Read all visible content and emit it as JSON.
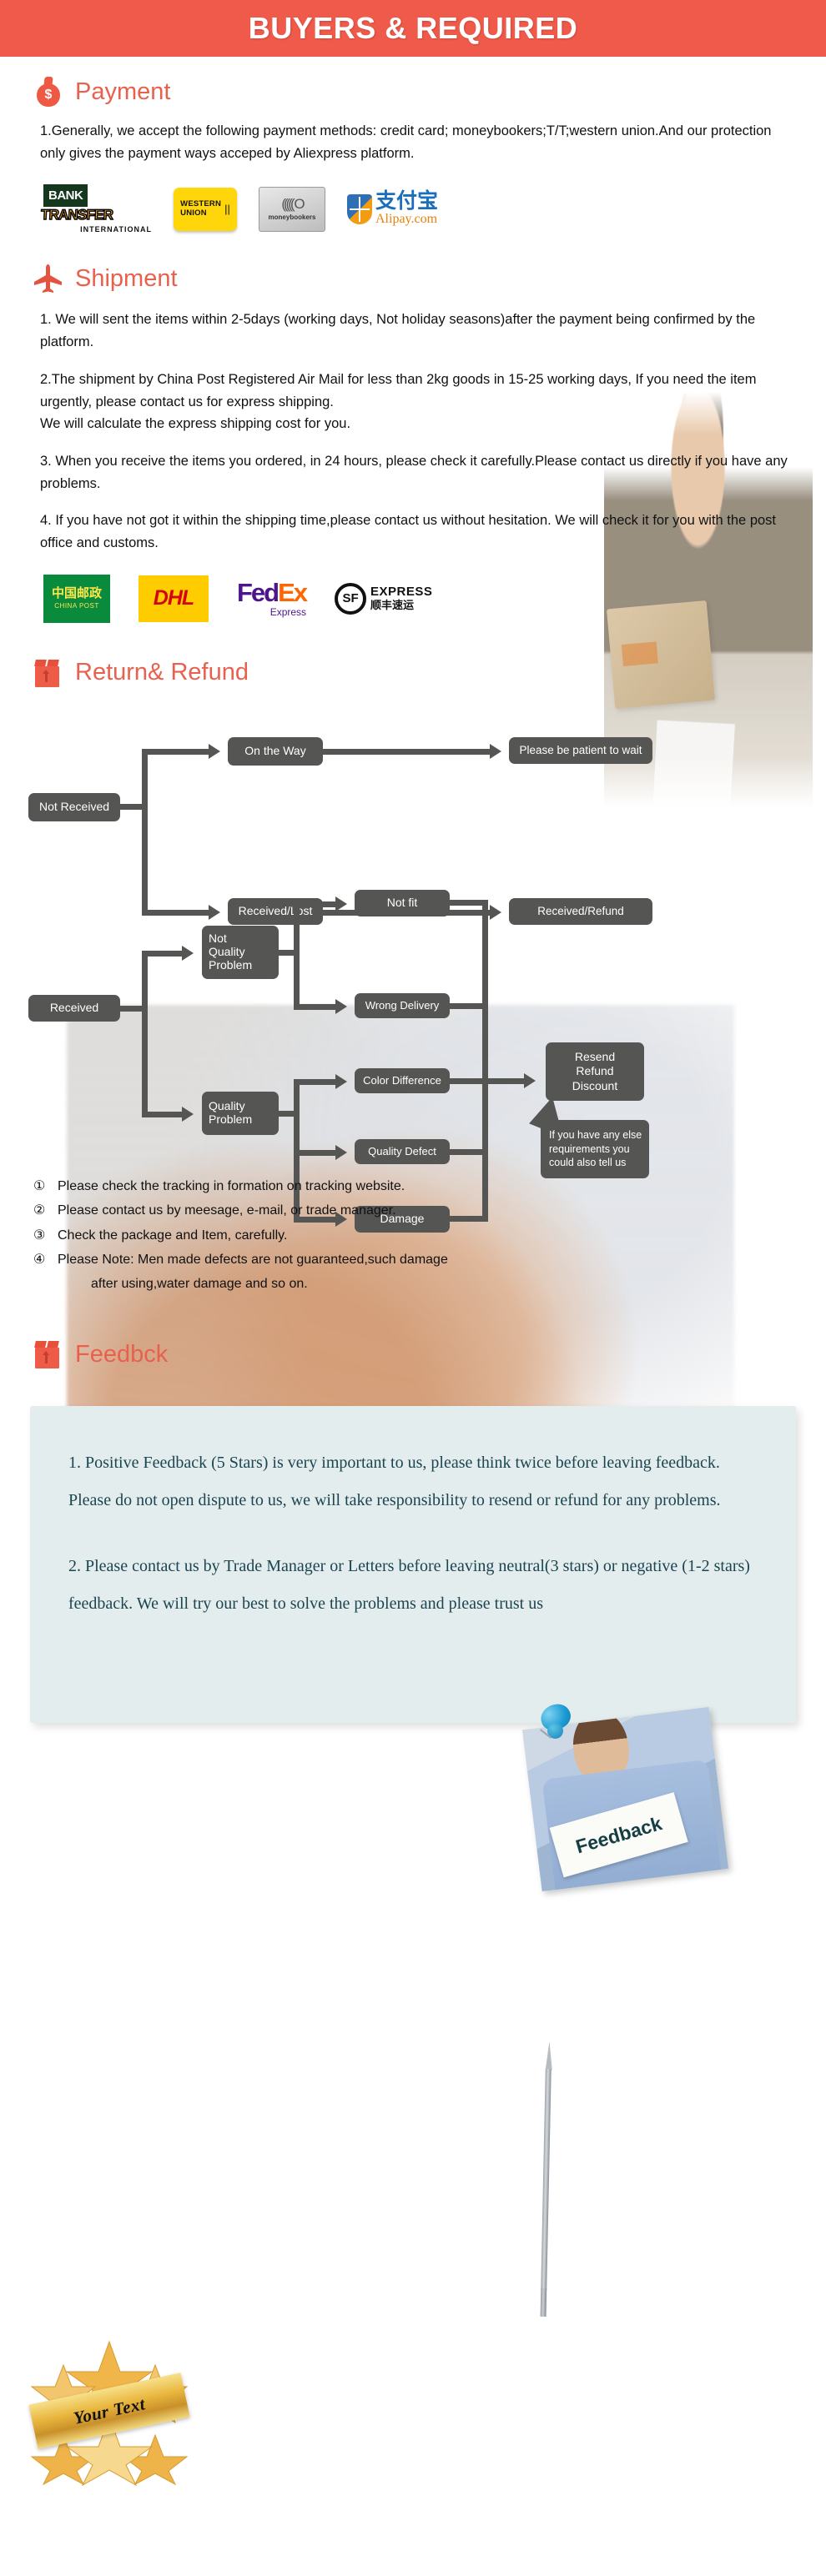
{
  "header": {
    "title": "BUYERS & REQUIRED"
  },
  "payment": {
    "icon": "money-bag-icon",
    "title": "Payment",
    "paragraphs": [
      "1.Generally, we accept the following payment methods: credit card; moneybookers;T/T;western union.And our protection only gives the payment ways acceped by Aliexpress platform."
    ],
    "logos": [
      {
        "name": "bank-transfer-logo",
        "main": "BANK",
        "accent": "TRANSFER",
        "sub": "INTERNATIONAL"
      },
      {
        "name": "western-union-logo",
        "line1": "WESTERN",
        "line2": "UNION"
      },
      {
        "name": "moneybookers-logo",
        "label": "moneybookers"
      },
      {
        "name": "alipay-logo",
        "zh": "支付宝",
        "domain": "Alipay.com"
      }
    ]
  },
  "shipment": {
    "icon": "airplane-icon",
    "title": "Shipment",
    "paragraphs": [
      "1. We will sent the items within 2-5days (working days, Not holiday seasons)after the payment being confirmed by the platform.",
      "2.The shipment by China Post Registered Air Mail for less than  2kg goods in 15-25 working days, If  you need the item urgently, please contact us for express shipping.",
      "We will calculate the express shipping cost for you.",
      "3. When you receive the items you ordered, in 24 hours, please check it carefully.Please contact us directly if you have any problems.",
      "4. If you have not got it within the shipping time,please contact us without hesitation. We will check it for you with the post office and customs."
    ],
    "logos": [
      {
        "name": "china-post-logo",
        "cn": "中国邮政",
        "en": "CHINA POST"
      },
      {
        "name": "dhl-logo",
        "label": "DHL"
      },
      {
        "name": "fedex-logo",
        "fed": "Fed",
        "ex": "Ex",
        "sub": "Express"
      },
      {
        "name": "sf-express-logo",
        "mark": "SF",
        "en": "EXPRESS",
        "cn": "顺丰速运"
      }
    ]
  },
  "return_refund": {
    "icon": "return-box-icon",
    "title": "Return& Refund",
    "flowchart": {
      "nodes": [
        {
          "id": "not-received",
          "label": "Not Received"
        },
        {
          "id": "on-the-way",
          "label": "On the Way"
        },
        {
          "id": "please-wait",
          "label": "Please be patient to wait"
        },
        {
          "id": "received-lost",
          "label": "Received/Lost"
        },
        {
          "id": "received-refund",
          "label": "Received/Refund"
        },
        {
          "id": "received",
          "label": "Received"
        },
        {
          "id": "not-quality-problem",
          "label": "Not\nQuality\nProblem"
        },
        {
          "id": "quality-problem",
          "label": "Quality\nProblem"
        },
        {
          "id": "not-fit",
          "label": "Not fit"
        },
        {
          "id": "wrong-delivery",
          "label": "Wrong Delivery"
        },
        {
          "id": "color-difference",
          "label": "Color Difference"
        },
        {
          "id": "quality-defect",
          "label": "Quality Defect"
        },
        {
          "id": "damage",
          "label": "Damage"
        },
        {
          "id": "resend-refund-discount",
          "label": "Resend\nRefund\nDiscount"
        },
        {
          "id": "callout",
          "label": "If you have any else\nrequirements you\ncould also tell us"
        }
      ]
    },
    "notes": [
      {
        "num": "①",
        "text": "Please check the tracking in formation on tracking website."
      },
      {
        "num": "②",
        "text": "Please contact us by meesage, e-mail, or trade manager."
      },
      {
        "num": "③",
        "text": "Check the package and Item, carefully."
      },
      {
        "num": "④",
        "text": "Please Note: Men made defects  are not guaranteed,such damage"
      }
    ],
    "note_continuation": "after using,water damage and so on."
  },
  "feedback": {
    "icon": "feedback-box-icon",
    "title": "Feedbck",
    "photo_sign_text": "Feedback",
    "paragraphs": [
      "1. Positive Feedback (5 Stars) is very important to us, please think twice before leaving feedback. Please do not open dispute to us,   we will take responsibility to resend or refund for any problems.",
      "2. Please contact us by Trade Manager or Letters before leaving neutral(3 stars) or negative (1-2 stars) feedback. We will try our best to solve the problems and please trust us"
    ]
  },
  "badge": {
    "label": "Your Text"
  },
  "colors": {
    "header_bg": "#f05a4a",
    "section_title": "#e8614e",
    "flow_node": "#555553",
    "feedback_panel": "#e4eded",
    "feedback_text": "#1c4551",
    "badge_gold": "#e8b53c"
  }
}
